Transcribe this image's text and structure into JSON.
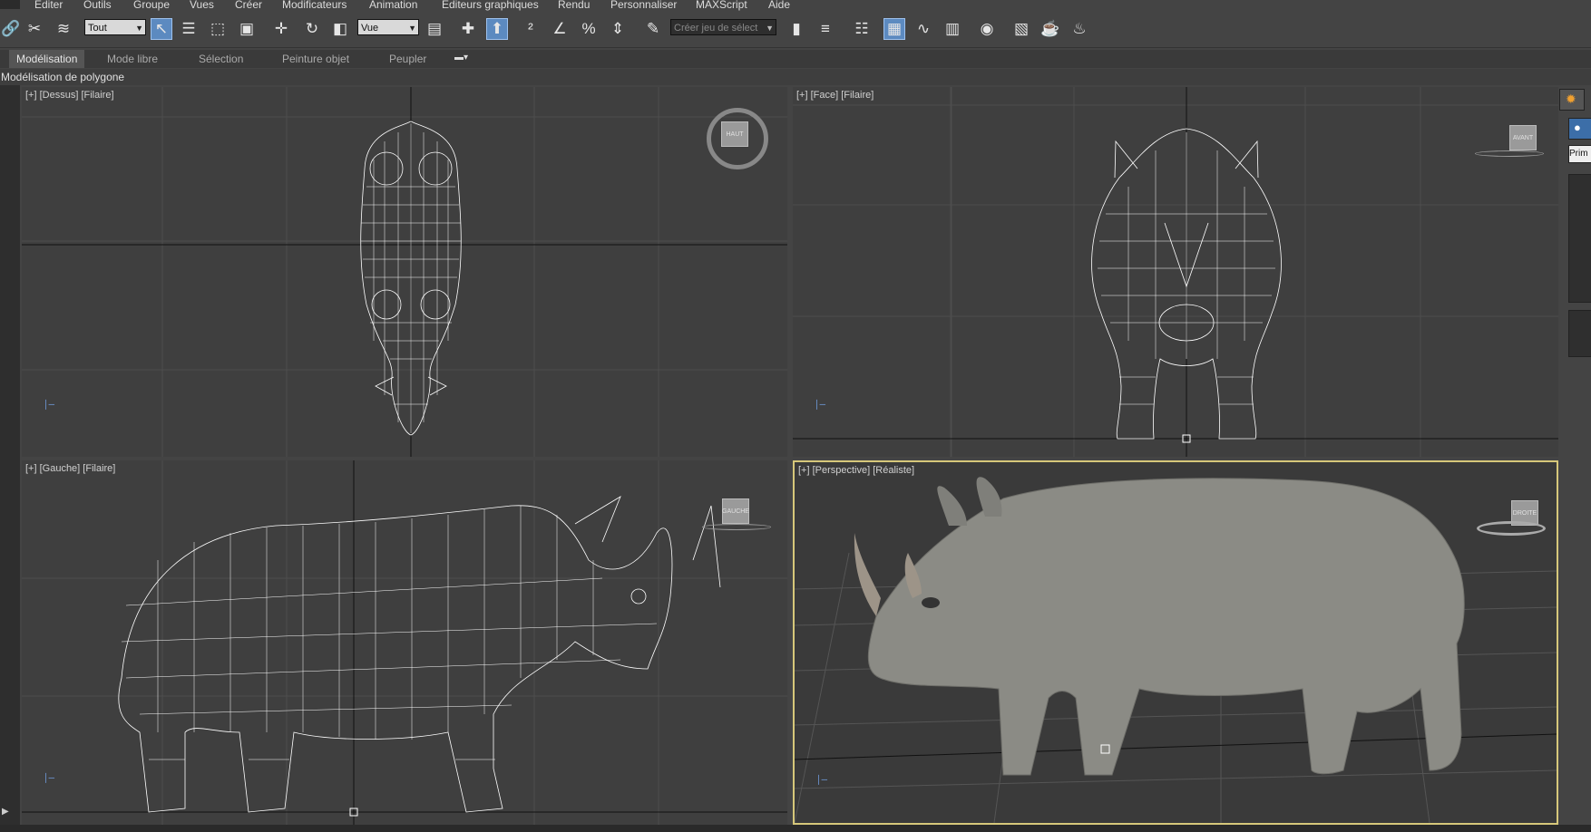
{
  "menu": [
    "Editer",
    "Outils",
    "Groupe",
    "Vues",
    "Créer",
    "Modificateurs",
    "Animation",
    "Editeurs graphiques",
    "Rendu",
    "Personnaliser",
    "MAXScript",
    "Aide"
  ],
  "toolbar": {
    "selection_filter": "Tout",
    "reference_coord": "Vue",
    "named_selection_placeholder": "Créer jeu de sélect"
  },
  "ribbon": {
    "tabs": [
      "Modélisation",
      "Mode libre",
      "Sélection",
      "Peinture objet",
      "Peupler"
    ],
    "active_tab": "Modélisation",
    "panel_label": "Modélisation de polygone"
  },
  "viewports": [
    {
      "label": "[+] [Dessus] [Filaire]",
      "viewcube": "HAUT"
    },
    {
      "label": "[+] [Face] [Filaire]",
      "viewcube": "AVANT"
    },
    {
      "label": "[+] [Gauche] [Filaire]",
      "viewcube": "GAUCHE"
    },
    {
      "label": "[+] [Perspective] [Réaliste]",
      "viewcube": "DROITE",
      "active": true
    }
  ],
  "right_panel": {
    "field_text": "Prim"
  },
  "colors": {
    "active_viewport_border": "#d6c77a",
    "viewport_bg": "#3f3f3f",
    "wireframe": "#ffffff",
    "toolbar_active": "#5c8ac0"
  }
}
